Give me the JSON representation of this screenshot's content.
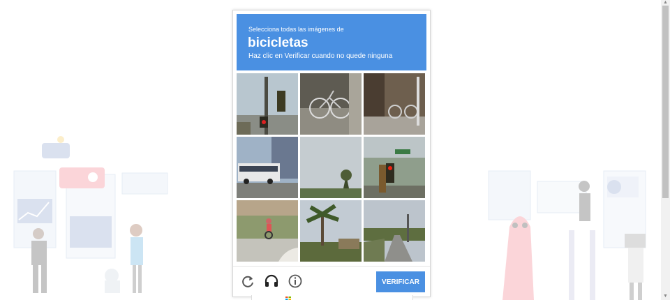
{
  "captcha": {
    "instruction_line1": "Selecciona todas las imágenes de",
    "target_word": "bicicletas",
    "instruction_line3": "Haz clic en Verificar cuando no quede ninguna",
    "verify_label": "VERIFICAR",
    "header_color": "#4a90e2"
  },
  "icons": [
    "reload-icon",
    "audio-challenge-icon",
    "info-icon"
  ]
}
